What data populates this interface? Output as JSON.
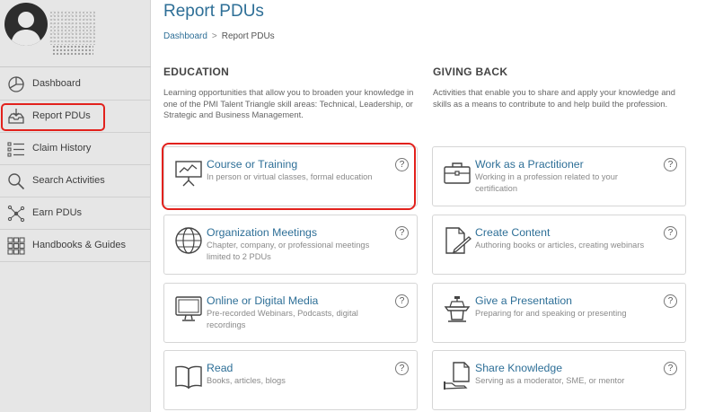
{
  "sidebar": {
    "items": [
      {
        "label": "Dashboard",
        "icon": "dashboard-icon"
      },
      {
        "label": "Report PDUs",
        "icon": "inbox-tray-icon"
      },
      {
        "label": "Claim History",
        "icon": "list-icon"
      },
      {
        "label": "Search Activities",
        "icon": "search-icon"
      },
      {
        "label": "Earn PDUs",
        "icon": "network-icon"
      },
      {
        "label": "Handbooks & Guides",
        "icon": "grid-icon"
      }
    ],
    "active_item": "Report PDUs"
  },
  "header": {
    "title": "Report PDUs",
    "breadcrumb": {
      "home": "Dashboard",
      "separator": ">",
      "current": "Report PDUs"
    }
  },
  "education": {
    "heading": "EDUCATION",
    "description": "Learning opportunities that allow you to broaden your knowledge in one of the PMI Talent Triangle skill areas: Technical, Leadership, or Strategic and Business Management.",
    "cards": [
      {
        "title": "Course or Training",
        "subtitle": "In person or virtual classes, formal education",
        "icon": "presentation-board-icon"
      },
      {
        "title": "Organization Meetings",
        "subtitle": "Chapter, company, or professional meetings limited to 2 PDUs",
        "icon": "globe-icon"
      },
      {
        "title": "Online or Digital Media",
        "subtitle": "Pre-recorded Webinars, Podcasts, digital recordings",
        "icon": "monitor-icon"
      },
      {
        "title": "Read",
        "subtitle": "Books, articles, blogs",
        "icon": "open-book-icon"
      }
    ]
  },
  "giving_back": {
    "heading": "GIVING BACK",
    "description": "Activities that enable you to share and apply your knowledge and skills as a means to contribute to and help build the profession.",
    "cards": [
      {
        "title": "Work as a Practitioner",
        "subtitle": "Working in a profession related to your certification",
        "icon": "briefcase-icon"
      },
      {
        "title": "Create Content",
        "subtitle": "Authoring books or articles, creating webinars",
        "icon": "document-pen-icon"
      },
      {
        "title": "Give a Presentation",
        "subtitle": "Preparing for and speaking or presenting",
        "icon": "podium-icon"
      },
      {
        "title": "Share Knowledge",
        "subtitle": "Serving as a moderator, SME, or mentor",
        "icon": "document-hand-icon"
      }
    ]
  },
  "help_glyph": "?",
  "colors": {
    "accent": "#2e6f97",
    "highlight": "#e2211c",
    "sidebar_bg": "#e6e6e6"
  }
}
